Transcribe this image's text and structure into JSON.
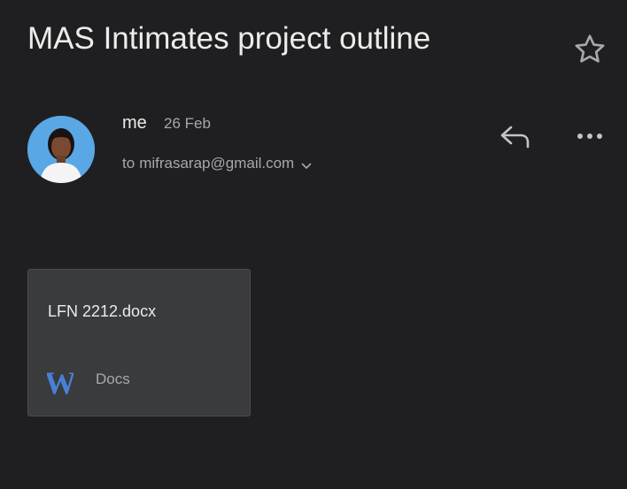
{
  "email": {
    "subject": "MAS Intimates project outline",
    "sender": "me",
    "date": "26 Feb",
    "to_label": "to",
    "recipient": "mifrasarap@gmail.com"
  },
  "actions": {
    "star_icon": "star-outline-icon",
    "reply_icon": "reply-icon",
    "more_icon": "more-horizontal-icon",
    "expand_icon": "chevron-down-icon"
  },
  "attachment": {
    "filename": "LFN 2212.docx",
    "type_label": "Docs",
    "icon": "word-doc-icon",
    "icon_letter": "W",
    "icon_color": "#4a7fd6"
  },
  "colors": {
    "background": "#1f1f21",
    "card": "#393b3d",
    "primary_text": "#ececec",
    "secondary_text": "#a8a8ab"
  }
}
